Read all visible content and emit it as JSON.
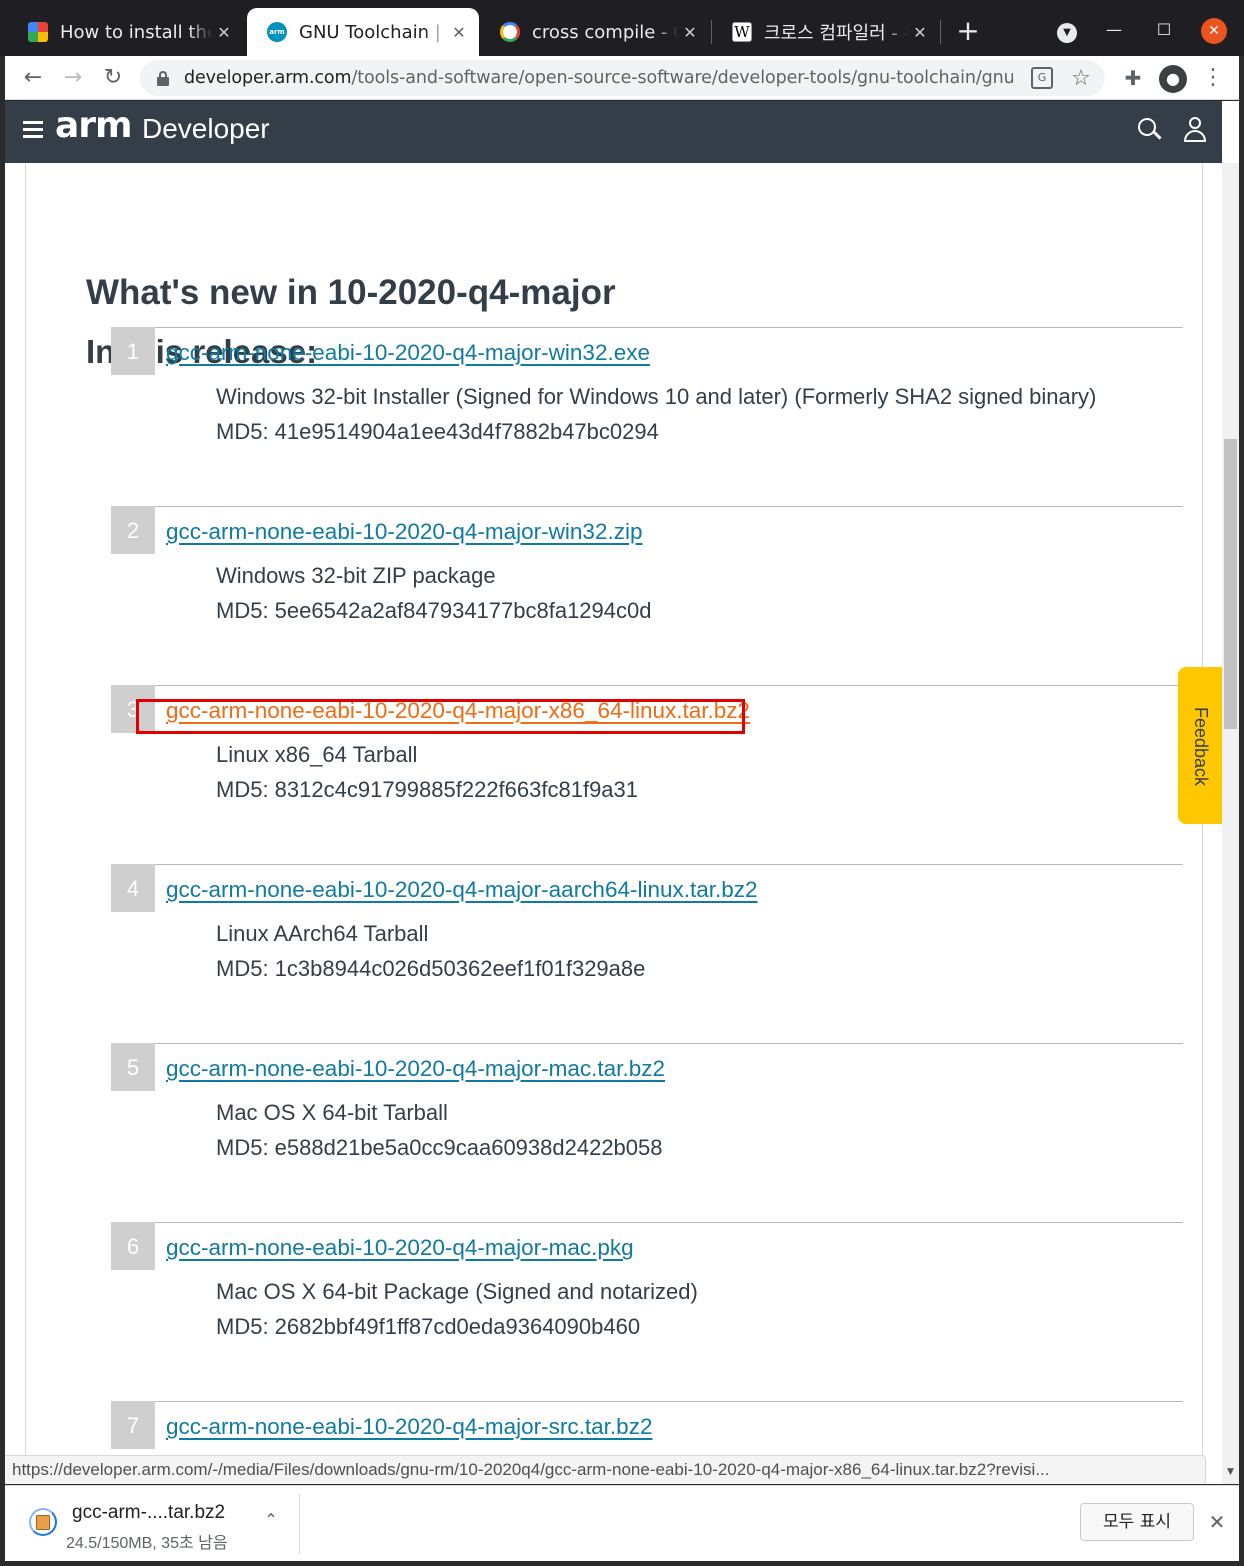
{
  "browser": {
    "tabs": [
      {
        "title": "How to install the",
        "favicon": "multicolor-icon",
        "active": false
      },
      {
        "title": "GNU Toolchain | G",
        "favicon": "arm-icon",
        "active": true
      },
      {
        "title": "cross compile - Go",
        "favicon": "google-icon",
        "active": false
      },
      {
        "title": "크로스 컴파일러 - 우",
        "favicon": "wikipedia-icon",
        "active": false
      }
    ],
    "new_tab_label": "+",
    "url_host": "developer.arm.com",
    "url_path": "/tools-and-software/open-source-software/developer-tools/gnu-toolchain/gnu-rm/...",
    "status_url": "https://developer.arm.com/-/media/Files/downloads/gnu-rm/10-2020q4/gcc-arm-none-eabi-10-2020-q4-major-x86_64-linux.tar.bz2?revisi..."
  },
  "site": {
    "logo": "arm",
    "section": "Developer",
    "header_color": "#333e48",
    "link_color": "#0f7aa2",
    "hover_link_color": "#ef6c14",
    "feedback_label": "Feedback",
    "feedback_color": "#ffc700"
  },
  "main": {
    "heading": "What's new in 10-2020-q4-major",
    "subheading": "In this release:",
    "items": [
      {
        "num": "1",
        "file": "gcc-arm-none-eabi-10-2020-q4-major-win32.exe",
        "desc": "Windows 32-bit Installer (Signed for Windows 10 and later) (Formerly SHA2 signed binary)",
        "md5": "MD5: 41e9514904a1ee43d4f7882b47bc0294"
      },
      {
        "num": "2",
        "file": "gcc-arm-none-eabi-10-2020-q4-major-win32.zip",
        "desc": "Windows 32-bit ZIP package",
        "md5": "MD5: 5ee6542a2af847934177bc8fa1294c0d"
      },
      {
        "num": "3",
        "file": "gcc-arm-none-eabi-10-2020-q4-major-x86_64-linux.tar.bz2",
        "desc": "Linux x86_64 Tarball",
        "md5": "MD5: 8312c4c91799885f222f663fc81f9a31",
        "highlighted": true
      },
      {
        "num": "4",
        "file": "gcc-arm-none-eabi-10-2020-q4-major-aarch64-linux.tar.bz2",
        "desc": "Linux AArch64 Tarball",
        "md5": "MD5: 1c3b8944c026d50362eef1f01f329a8e"
      },
      {
        "num": "5",
        "file": "gcc-arm-none-eabi-10-2020-q4-major-mac.tar.bz2",
        "desc": "Mac OS X 64-bit Tarball",
        "md5": "MD5: e588d21be5a0cc9caa60938d2422b058"
      },
      {
        "num": "6",
        "file": "gcc-arm-none-eabi-10-2020-q4-major-mac.pkg",
        "desc": "Mac OS X 64-bit Package (Signed and notarized)",
        "md5": "MD5: 2682bbf49f1ff87cd0eda9364090b460"
      },
      {
        "num": "7",
        "file": "gcc-arm-none-eabi-10-2020-q4-major-src.tar.bz2",
        "desc": "",
        "md5": ""
      }
    ]
  },
  "download_shelf": {
    "filename": "gcc-arm-....tar.bz2",
    "progress": "24.5/150MB, 35초 남음",
    "show_all_label": "모두 표시"
  }
}
